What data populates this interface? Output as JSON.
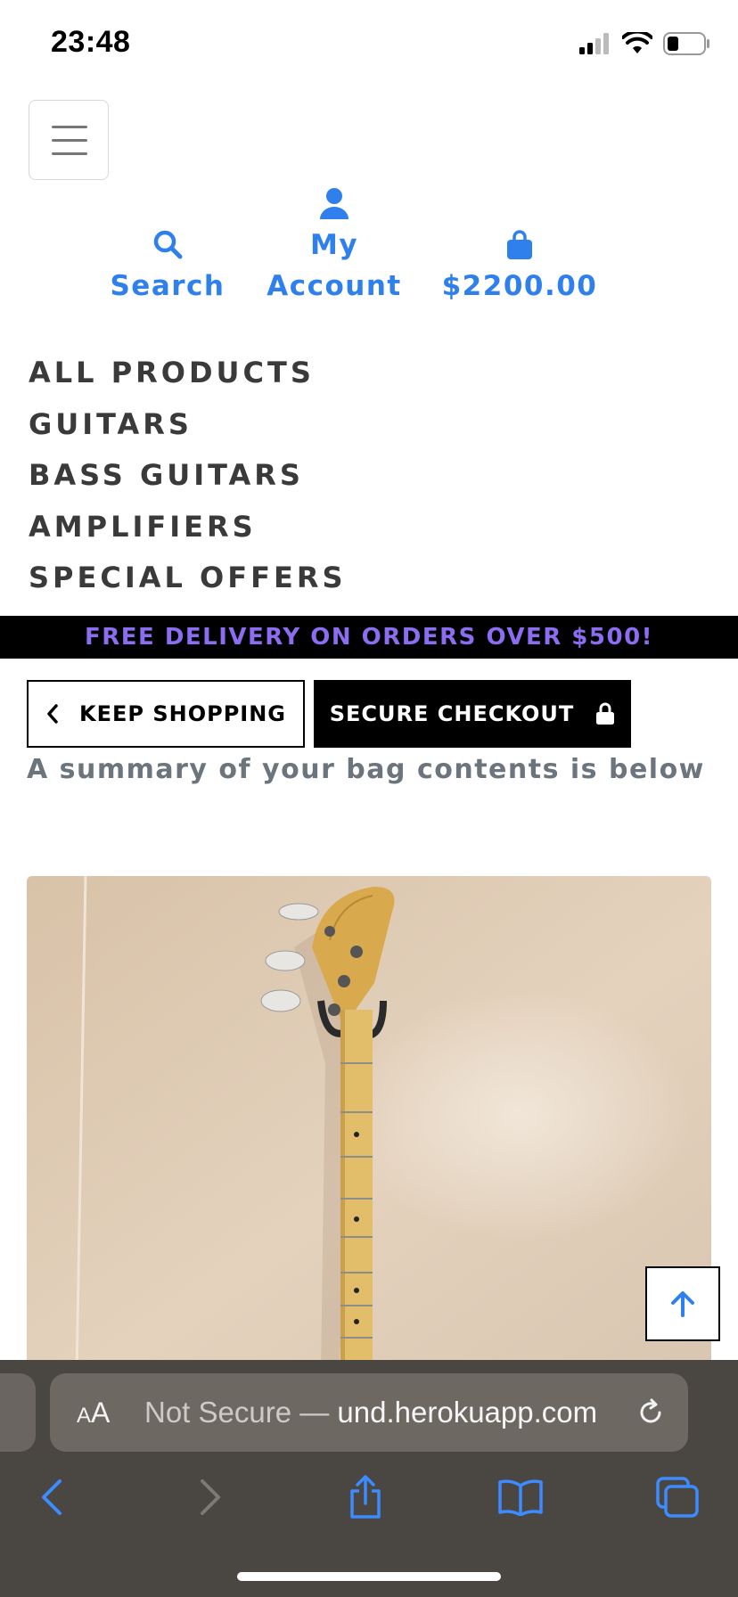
{
  "status_bar": {
    "time": "23:48"
  },
  "header": {
    "menu_label": "",
    "search": {
      "label": "Search"
    },
    "account": {
      "line1": "My",
      "line2": "Account"
    },
    "bag": {
      "total": "$2200.00"
    }
  },
  "nav": {
    "items": [
      {
        "label": "ALL PRODUCTS"
      },
      {
        "label": "GUITARS"
      },
      {
        "label": "BASS GUITARS"
      },
      {
        "label": "AMPLIFIERS"
      },
      {
        "label": "SPECIAL OFFERS"
      }
    ]
  },
  "banner": {
    "text": "FREE DELIVERY ON ORDERS OVER $500!"
  },
  "buttons": {
    "keep_shopping": "KEEP SHOPPING",
    "secure_checkout": "SECURE CHECKOUT"
  },
  "summary": {
    "text": "A summary of your bag contents is below"
  },
  "browser": {
    "aa": "AA",
    "url_prefix": "Not Secure — ",
    "url_host": "und.herokuapp.com"
  },
  "colors": {
    "accent": "#2f80ed",
    "banner_bg": "#000000",
    "banner_text": "#8c6cf0",
    "nav_text": "#3a3a3a",
    "summary_text": "#6c757d"
  }
}
